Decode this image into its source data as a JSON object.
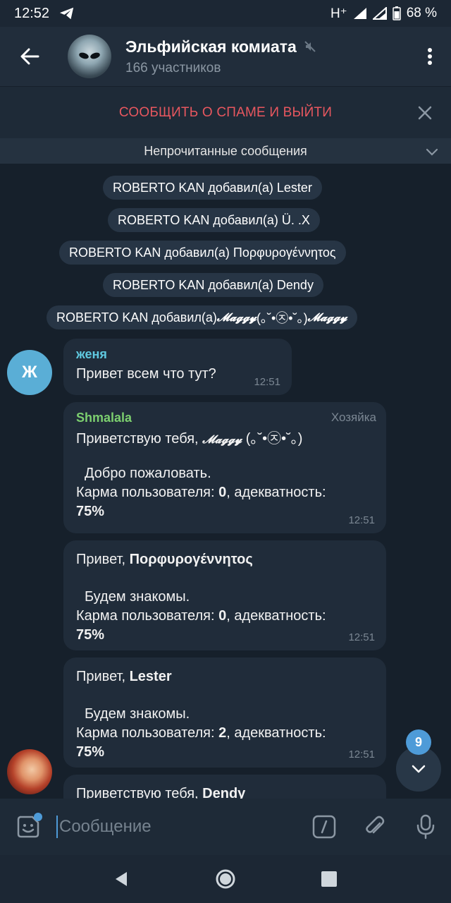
{
  "status_bar": {
    "time": "12:52",
    "network": "H⁺",
    "battery": "68 %"
  },
  "header": {
    "title": "Эльфийская комиата",
    "subtitle": "166 участников",
    "icons": {
      "back": "arrow-left-icon",
      "mute": "mute-icon",
      "menu": "more-vertical-icon"
    }
  },
  "spam_bar": {
    "label": "СООБЩИТЬ О СПАМЕ И ВЫЙТИ"
  },
  "unread_bar": {
    "label": "Непрочитанные сообщения"
  },
  "service_messages": [
    {
      "text": "ROBERTO KAN добавил(а) Lester"
    },
    {
      "text": "ROBERTO KAN добавил(а) Ü. .X"
    },
    {
      "text": "ROBERTO KAN добавил(а) Πορφυρογέννητος"
    },
    {
      "text": "ROBERTO KAN добавил(а) Dendy"
    },
    {
      "prefix": "ROBERTO KAN добавил(а) ",
      "styled": "𝓜𝓪𝓰𝓰𝔂",
      "suffix": " (｡˘•㉨•˘｡) ",
      "styled2": "𝓜𝓪𝓰𝓰𝔂"
    }
  ],
  "messages": [
    {
      "avatar_letter": "Ж",
      "avatar_color": "#5aaed6",
      "sender": "женя",
      "sender_color": "#5fc9e0",
      "text": "Привет всем что тут?",
      "time": "12:51"
    },
    {
      "sender": "Shmalala",
      "sender_color": "#7ccf6f",
      "role": "Хозяйка",
      "line1_prefix": "Приветствую тебя, ",
      "line1_styled": "𝓜𝓪𝓰𝓰𝔂",
      "line1_suffix": " (｡˘•㉨•˘｡)",
      "line2": "Добро пожаловать.",
      "line3_prefix": "Карма пользователя: ",
      "line3_karma": "0",
      "line3_mid": ", адекватность:",
      "line4": "75%",
      "time": "12:51"
    },
    {
      "line1_prefix": "Привет, ",
      "line1_name": "Πορφυρογέννητος",
      "line2": "Будем знакомы.",
      "line3_prefix": "Карма пользователя: ",
      "line3_karma": "0",
      "line3_mid": ", адекватность:",
      "line4": "75%",
      "time": "12:51"
    },
    {
      "line1_prefix": "Привет, ",
      "line1_name": "Lester",
      "line2": "Будем знакомы.",
      "line3_prefix": "Карма пользователя: ",
      "line3_karma": "2",
      "line3_mid": ", адекватность:",
      "line4": "75%",
      "time": "12:51"
    },
    {
      "line1_prefix": "Приветствую тебя, ",
      "line1_name": "Dendy"
    }
  ],
  "scroll_badge": {
    "count": "9"
  },
  "input": {
    "placeholder": "Сообщение"
  },
  "colors": {
    "accent": "#4e9bd8",
    "spam": "#e8575f",
    "bubble": "#202c3a",
    "background": "#16202b"
  }
}
